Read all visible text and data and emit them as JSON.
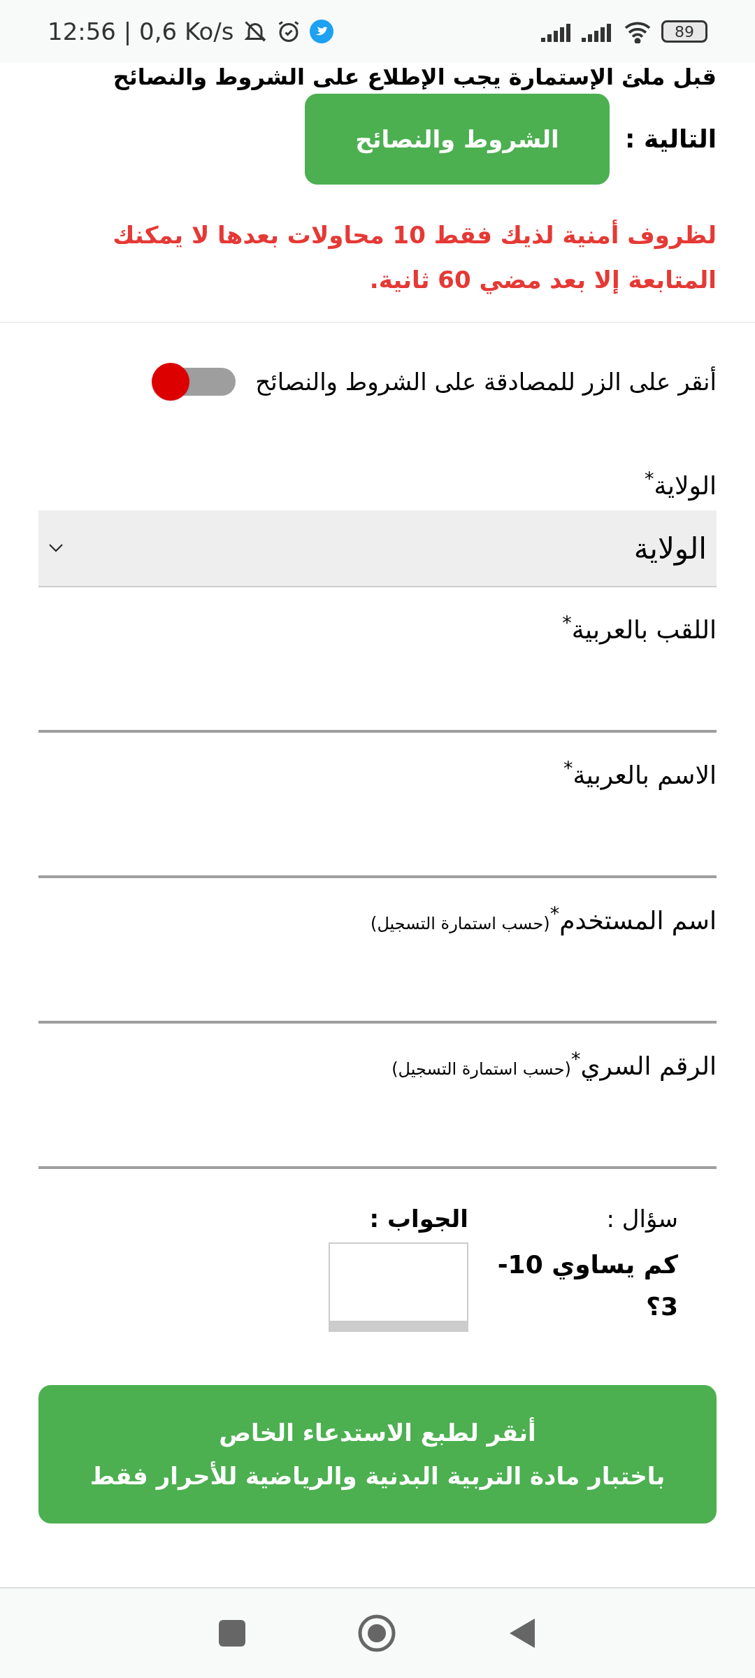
{
  "status_bar": {
    "time": "12:56 | 0,6 Ko/s",
    "battery": "89"
  },
  "intro": {
    "cut_line": "قبل ملئ الإستمارة يجب الإطلاع على الشروط والنصائح",
    "label": "التالية :",
    "button": "الشروط والنصائح"
  },
  "warning": "لظروف أمنية لذيك فقط 10 محاولات بعدها لا يمكنك المتابعة إلا بعد مضي 60 ثانية.",
  "agree_toggle": {
    "label": "أنقر على الزر للمصادقة على الشروط والنصائح",
    "on": false
  },
  "state_select": {
    "label": "الولاية",
    "required": "*",
    "value": "الولاية"
  },
  "fields": [
    {
      "label": "اللقب بالعربية",
      "required": "*"
    },
    {
      "label": "الاسم بالعربية",
      "required": "*"
    },
    {
      "label": "اسم المستخدم",
      "required": "*",
      "hint": "(حسب استمارة التسجيل)"
    },
    {
      "label": "الرقم السري",
      "required": "*",
      "hint": "(حسب استمارة التسجيل)"
    }
  ],
  "captcha": {
    "question_label": "سؤال :",
    "question": "كم يساوي 10-3؟",
    "answer_label": "الجواب :"
  },
  "submit": {
    "line_1": "أنقر لطبع الاستدعاء الخاص",
    "line_2": "باختبار مادة التربية البدنية والرياضية للأحرار فقط"
  }
}
